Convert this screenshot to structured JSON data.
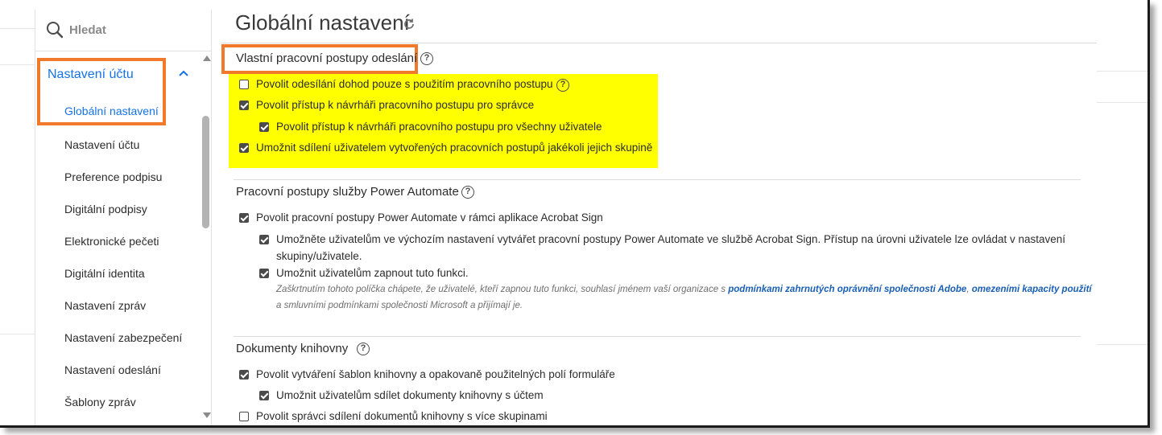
{
  "search": {
    "placeholder": "Hledat"
  },
  "sidebar": {
    "parent_label": "Nastavení účtu",
    "active_child": "Globální nastavení",
    "items": [
      "Nastavení účtu",
      "Preference podpisu",
      "Digitální podpisy",
      "Elektronické pečeti",
      "Digitální identita",
      "Nastavení zpráv",
      "Nastavení zabezpečení",
      "Nastavení odeslání",
      "Šablony zpráv"
    ]
  },
  "main": {
    "title": "Globální nastavení",
    "sections": [
      {
        "title": "Vlastní pracovní postupy odeslání",
        "options": [
          {
            "label": "Povolit odesílání dohod pouze s použitím pracovního postupu",
            "checked": false
          },
          {
            "label": "Povolit přístup k návrháři pracovního postupu pro správce",
            "checked": true
          },
          {
            "label": "Povolit přístup k návrháři pracovního postupu pro všechny uživatele",
            "checked": true
          },
          {
            "label": "Umožnit sdílení uživatelem vytvořených pracovních postupů jakékoli jejich skupině",
            "checked": true
          }
        ]
      },
      {
        "title": "Pracovní postupy služby Power Automate",
        "options": [
          {
            "label": "Povolit pracovní postupy Power Automate v rámci aplikace Acrobat Sign",
            "checked": true
          },
          {
            "label": "Umožněte uživatelům ve výchozím nastavení vytvářet pracovní postupy Power Automate ve službě Acrobat Sign. Přístup na úrovni uživatele lze ovládat v nastavení",
            "label_line2": "skupiny/uživatele.",
            "checked": true
          },
          {
            "label": "Umožnit uživatelům zapnout tuto funkci.",
            "checked": true
          }
        ],
        "note": {
          "prefix": "Zaškrtnutím tohoto políčka chápete, že uživatelé, kteří zapnou tuto funkci, souhlasí jménem vaší organizace s ",
          "link1": "podmínkami zahrnutých oprávnění společnosti Adobe",
          "sep": ", ",
          "link2": "omezeními kapacity použití",
          "line2": "a smluvními podmínkami společnosti Microsoft a přijímají je."
        }
      },
      {
        "title": "Dokumenty knihovny",
        "options": [
          {
            "label": "Povolit vytváření šablon knihovny a opakovaně použitelných polí formuláře",
            "checked": true
          },
          {
            "label": "Umožnit uživatelům sdílet dokumenty knihovny s účtem",
            "checked": true
          },
          {
            "label": "Povolit správci sdílení dokumentů knihovny s více skupinami",
            "checked": false
          }
        ]
      }
    ]
  },
  "colors": {
    "accent": "#1473e6",
    "highlight_box": "#f0792b",
    "highlight_fill": "#ffff00"
  },
  "icons": [
    "search-icon",
    "chevron-up-icon",
    "refresh-icon",
    "help-icon"
  ]
}
